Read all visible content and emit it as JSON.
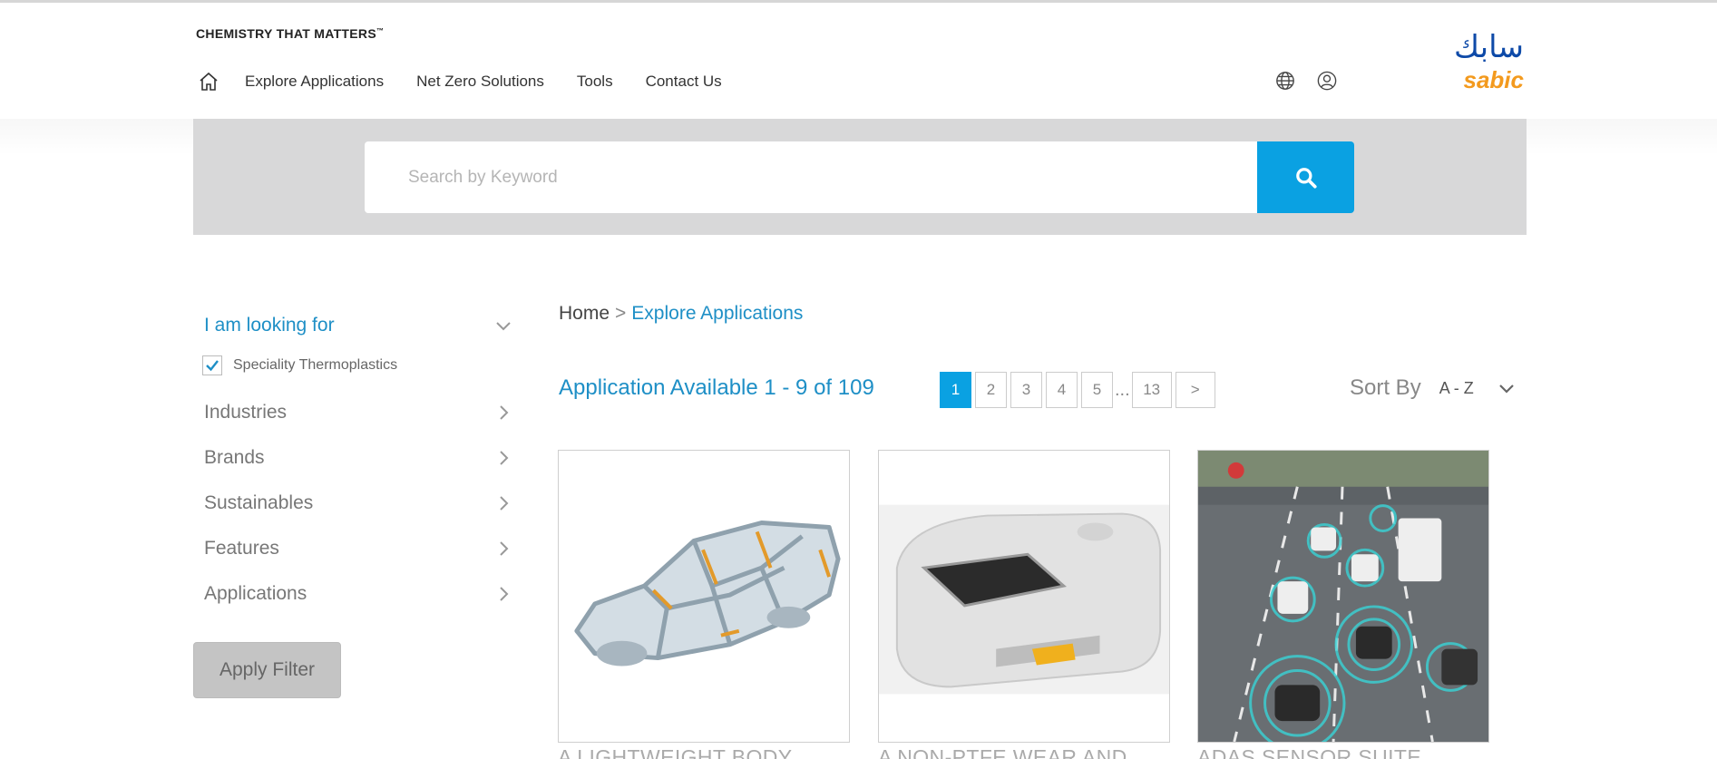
{
  "header": {
    "tagline": "CHEMISTRY THAT MATTERS",
    "tagline_tm": "™",
    "nav": {
      "explore": "Explore Applications",
      "net_zero": "Net Zero Solutions",
      "tools": "Tools",
      "contact": "Contact Us"
    },
    "logo_arabic": "سابك",
    "logo_latin": "sabic"
  },
  "search": {
    "placeholder": "Search by Keyword",
    "value": ""
  },
  "sidebar": {
    "looking_for_label": "I am looking for",
    "checked_item": "Speciality Thermoplastics",
    "filters": {
      "industries": "Industries",
      "brands": "Brands",
      "sustainables": "Sustainables",
      "features": "Features",
      "applications": "Applications"
    },
    "apply_label": "Apply Filter"
  },
  "breadcrumb": {
    "home": "Home",
    "separator": ">",
    "current": "Explore Applications"
  },
  "results": {
    "text": "Application Available 1 - 9 of 109"
  },
  "pagination": {
    "p1": "1",
    "p2": "2",
    "p3": "3",
    "p4": "4",
    "p5": "5",
    "ellipsis": "...",
    "last": "13",
    "next": ">"
  },
  "sort": {
    "label": "Sort By",
    "value": "A - Z"
  },
  "cards": {
    "c1_title": "A LIGHTWEIGHT BODY",
    "c2_title": "A NON-PTFE WEAR AND",
    "c3_title": "ADAS SENSOR SUITE"
  },
  "colors": {
    "accent": "#0aa1e2",
    "link": "#1e8fc6",
    "logo_blue": "#0e4aa8",
    "logo_orange": "#f39a1e"
  }
}
